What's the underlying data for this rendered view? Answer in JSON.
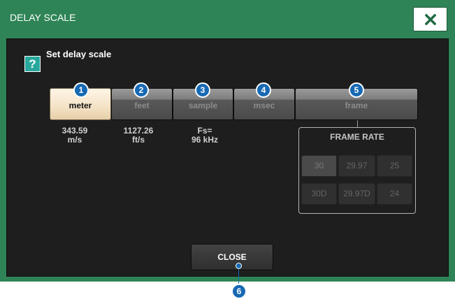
{
  "dialog": {
    "title": "DELAY SCALE",
    "help_icon": "?",
    "help_text": "Set delay scale",
    "close_x_icon": "close-icon"
  },
  "scale_buttons": [
    {
      "label": "meter",
      "badge": "1",
      "active": true
    },
    {
      "label": "feet",
      "badge": "2",
      "active": false
    },
    {
      "label": "sample",
      "badge": "3",
      "active": false
    },
    {
      "label": "msec",
      "badge": "4",
      "active": false
    },
    {
      "label": "frame",
      "badge": "5",
      "active": false
    }
  ],
  "scale_info": {
    "meter_value": "343.59",
    "meter_unit": "m/s",
    "feet_value": "1127.26",
    "feet_unit": "ft/s",
    "sample_line1": "Fs=",
    "sample_line2": "96 kHz"
  },
  "frame_rate": {
    "title": "FRAME RATE",
    "options": [
      "30",
      "29.97",
      "25",
      "30D",
      "29.97D",
      "24"
    ],
    "selected": "30"
  },
  "close_button": {
    "label": "CLOSE",
    "badge": "6"
  },
  "colors": {
    "title_bar": "#2e8456",
    "panel": "#1e1e1e",
    "active_button": "#f4e2c6",
    "badge": "#1769b3",
    "help_icon": "#28a89c"
  }
}
